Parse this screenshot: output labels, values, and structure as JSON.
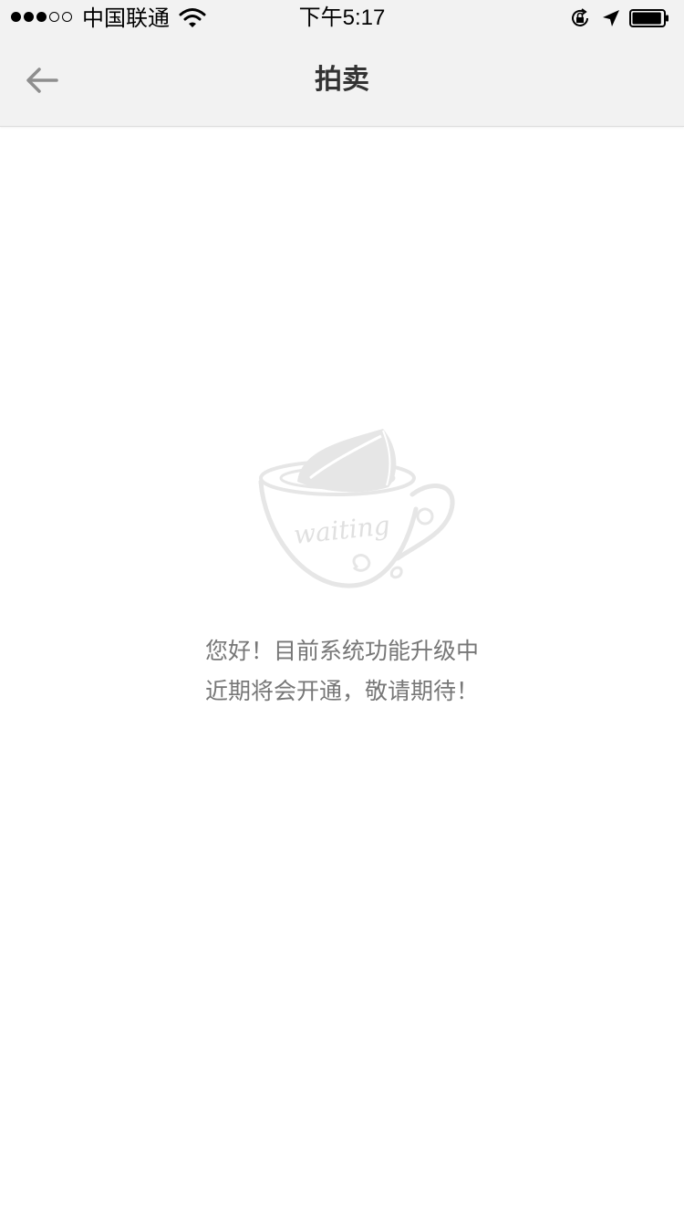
{
  "status_bar": {
    "signal_dots": [
      "full",
      "full",
      "full",
      "empty",
      "empty"
    ],
    "carrier": "中国联通",
    "time": "下午5:17",
    "icons": [
      "wifi-icon",
      "orientation-lock-icon",
      "location-arrow-icon",
      "battery-icon"
    ],
    "battery_level": 0.95
  },
  "nav": {
    "title": "拍卖",
    "back_icon": "back-arrow-icon"
  },
  "content": {
    "illustration": {
      "icon": "coffee-cup-icon",
      "label": "waiting"
    },
    "message_line_1": "您好！目前系统功能升级中",
    "message_line_2": "近期将会开通，敬请期待！"
  },
  "colors": {
    "bar_background": "#f2f2f2",
    "title_text": "#333333",
    "message_text": "#777777",
    "illustration": "#e6e6e6"
  }
}
